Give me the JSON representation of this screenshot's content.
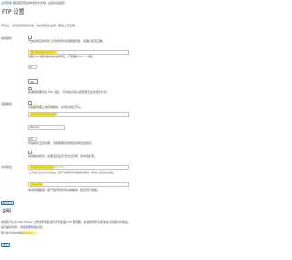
{
  "top_note": {
    "link": "设置帮助",
    "text": "相应配置项请参考官方文档，设置好后保存"
  },
  "section_title": "FTP 设置",
  "intro": "开启后，如果发现连接失败，请检查相关设置，确保上传正确",
  "fields": {
    "enable": {
      "label": "启用插件",
      "help": "开启后将自动同步上传的附件到远程服务器，请确认配置正确。"
    },
    "host": {
      "label": "FTP服务器地址",
      "value": "ftp.example.com",
      "help": "远程 FTP 服务器的地址或域名，不需要加 ftp:// 前缀。"
    },
    "port": {
      "value": "21"
    },
    "timeout": {
      "value": "90",
      "help": "连接超时时间（秒），超过此时间将断开连接。"
    },
    "ssl": {
      "help": "如果服务器支持 SSL 连接，可勾选此项以使用更安全的连接方式。"
    },
    "path": {
      "label": "远程路径",
      "value": "/wp-content/uploads",
      "help": "远程服务器上的存储路径，必须以斜杠开头。"
    },
    "user": {
      "value": "ftpuser"
    },
    "password": {
      "value": "",
      "help": "FTP 登录账号的密码。"
    },
    "mode": {
      "value": "10",
      "help": "传输模式设置说明，请根据服务器类型选择合适的值。"
    },
    "passive": {
      "help": "启用被动模式，如果连接后无法列出目录，请勾选此项。"
    },
    "url": {
      "label": "访问地址",
      "value": "https://cdn.example.com",
      "help": "上传后文件的访问地址，用于替换附件的链接地址，通常为绑定的域名。"
    },
    "local": {
      "value": "/uploads",
      "help": "本地存储路径，用于保存附件的本地副本，留空则不保留。"
    }
  },
  "save_button": "保存更改",
  "section2_title": "说明",
  "notes": [
    "本插件可以将 WordPress 上传的附件自动同步到远程 FTP 服务器，并替换附件链接地址为远程访问地址。",
    "如果遇到问题，请检查服务器设置。",
    "更多信息请参考插件文档。"
  ],
  "bottom_button": "保存"
}
